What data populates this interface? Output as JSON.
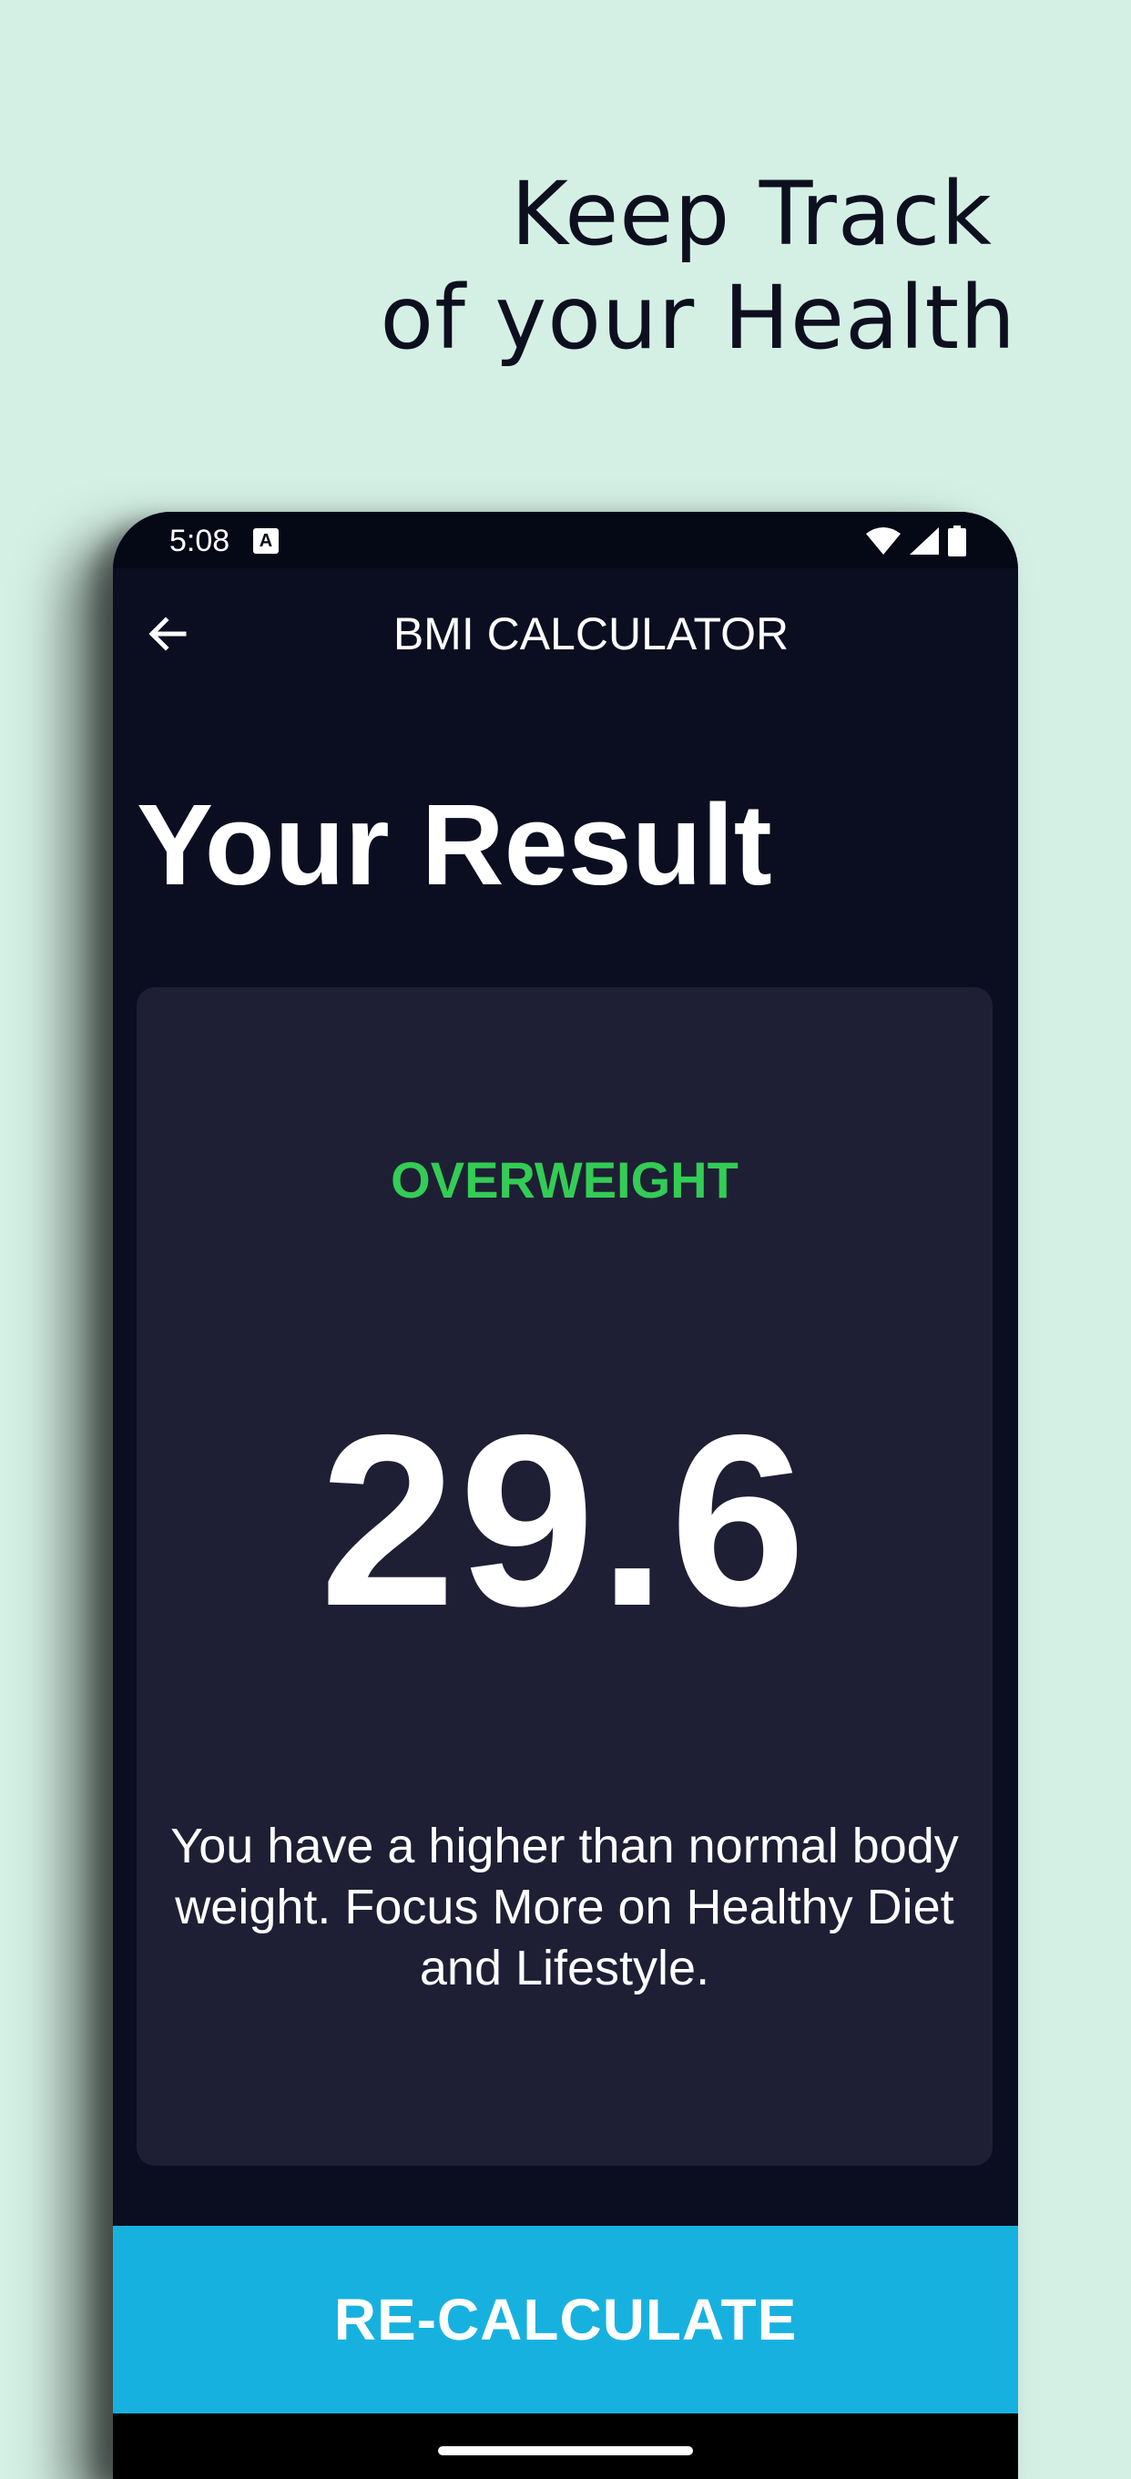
{
  "promo": {
    "line1": "Keep Track",
    "line2": "of your Health"
  },
  "status_bar": {
    "time": "5:08",
    "notification_icon_letter": "A",
    "icons": [
      "wifi-icon",
      "signal-icon",
      "battery-icon"
    ]
  },
  "app_bar": {
    "back_icon": "arrow-left-icon",
    "title": "BMI CALCULATOR"
  },
  "result": {
    "heading": "Your Result",
    "category": "OVERWEIGHT",
    "bmi": "29.6",
    "advice": "You have a higher than normal body weight. Focus More on Healthy Diet and Lifestyle."
  },
  "actions": {
    "recalculate_label": "RE-CALCULATE"
  },
  "colors": {
    "background": "#d4f0e4",
    "app_background": "#0a0e20",
    "card": "#1e1f34",
    "category_green": "#33cc55",
    "button_blue": "#17b1e0"
  }
}
